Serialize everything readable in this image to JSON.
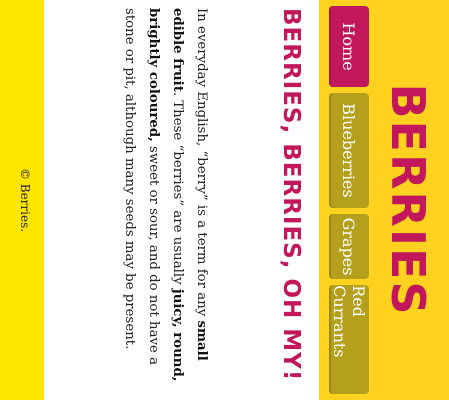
{
  "site": {
    "title": "BERRIES"
  },
  "nav": {
    "items": [
      {
        "label": "Home",
        "active": true
      },
      {
        "label": "Blueberries",
        "active": false
      },
      {
        "label": "Grapes",
        "active": false
      },
      {
        "label": "Red Currants",
        "active": false
      }
    ]
  },
  "main": {
    "heading": "BERRIES, BERRIES, OH MY!",
    "paragraph": {
      "t1": "In everyday English, “berry” is a term for any ",
      "b1": "small edible fruit",
      "t2": ". These “berries” are usually ",
      "b2": "juicy, round, brightly coloured,",
      "t3": " sweet or sour, and do not have a stone or pit, although many seeds may be present."
    }
  },
  "footer": {
    "copyright": "© Berries."
  },
  "colors": {
    "accent": "#c2185b",
    "header_bg": "#ffd21f",
    "page_bg": "#ffe600",
    "nav_bg": "#b5a01e"
  }
}
